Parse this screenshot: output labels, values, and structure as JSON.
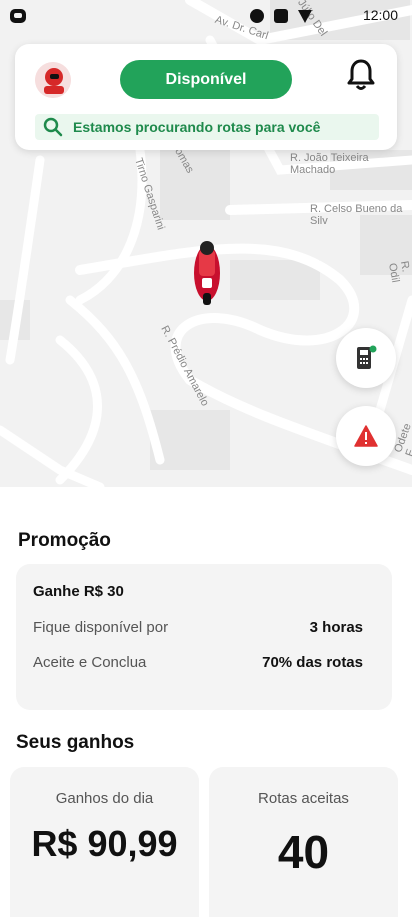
{
  "status_bar": {
    "time": "12:00",
    "icons": [
      "app-icon",
      "circle-icon",
      "square-icon",
      "wifi-icon"
    ]
  },
  "map": {
    "streets": [
      "Av. Dr. Carl",
      "R. Júlio Del",
      "R. João Teixeira Machado",
      "R. Celso Bueno da Silv",
      "Tirno Gasparini",
      "R. Prédio Amarelo",
      "nomas",
      "R. Odil",
      "R. Odete F."
    ]
  },
  "header": {
    "status_label": "Disponível",
    "search_message": "Estamos procurando rotas para você"
  },
  "promotion": {
    "section_title": "Promoção",
    "title": "Ganhe R$ 30",
    "rows": [
      {
        "label": "Fique disponível por",
        "value": "3 horas"
      },
      {
        "label": "Aceite e Conclua",
        "value": "70% das rotas"
      }
    ]
  },
  "earnings": {
    "section_title": "Seus ganhos",
    "daily_label": "Ganhos do dia",
    "daily_value": "R$ 90,99",
    "routes_label": "Rotas aceitas",
    "routes_value": "40"
  },
  "colors": {
    "accent": "#22a35a",
    "warning": "#e03131",
    "map_bg": "#f2f2f2"
  }
}
